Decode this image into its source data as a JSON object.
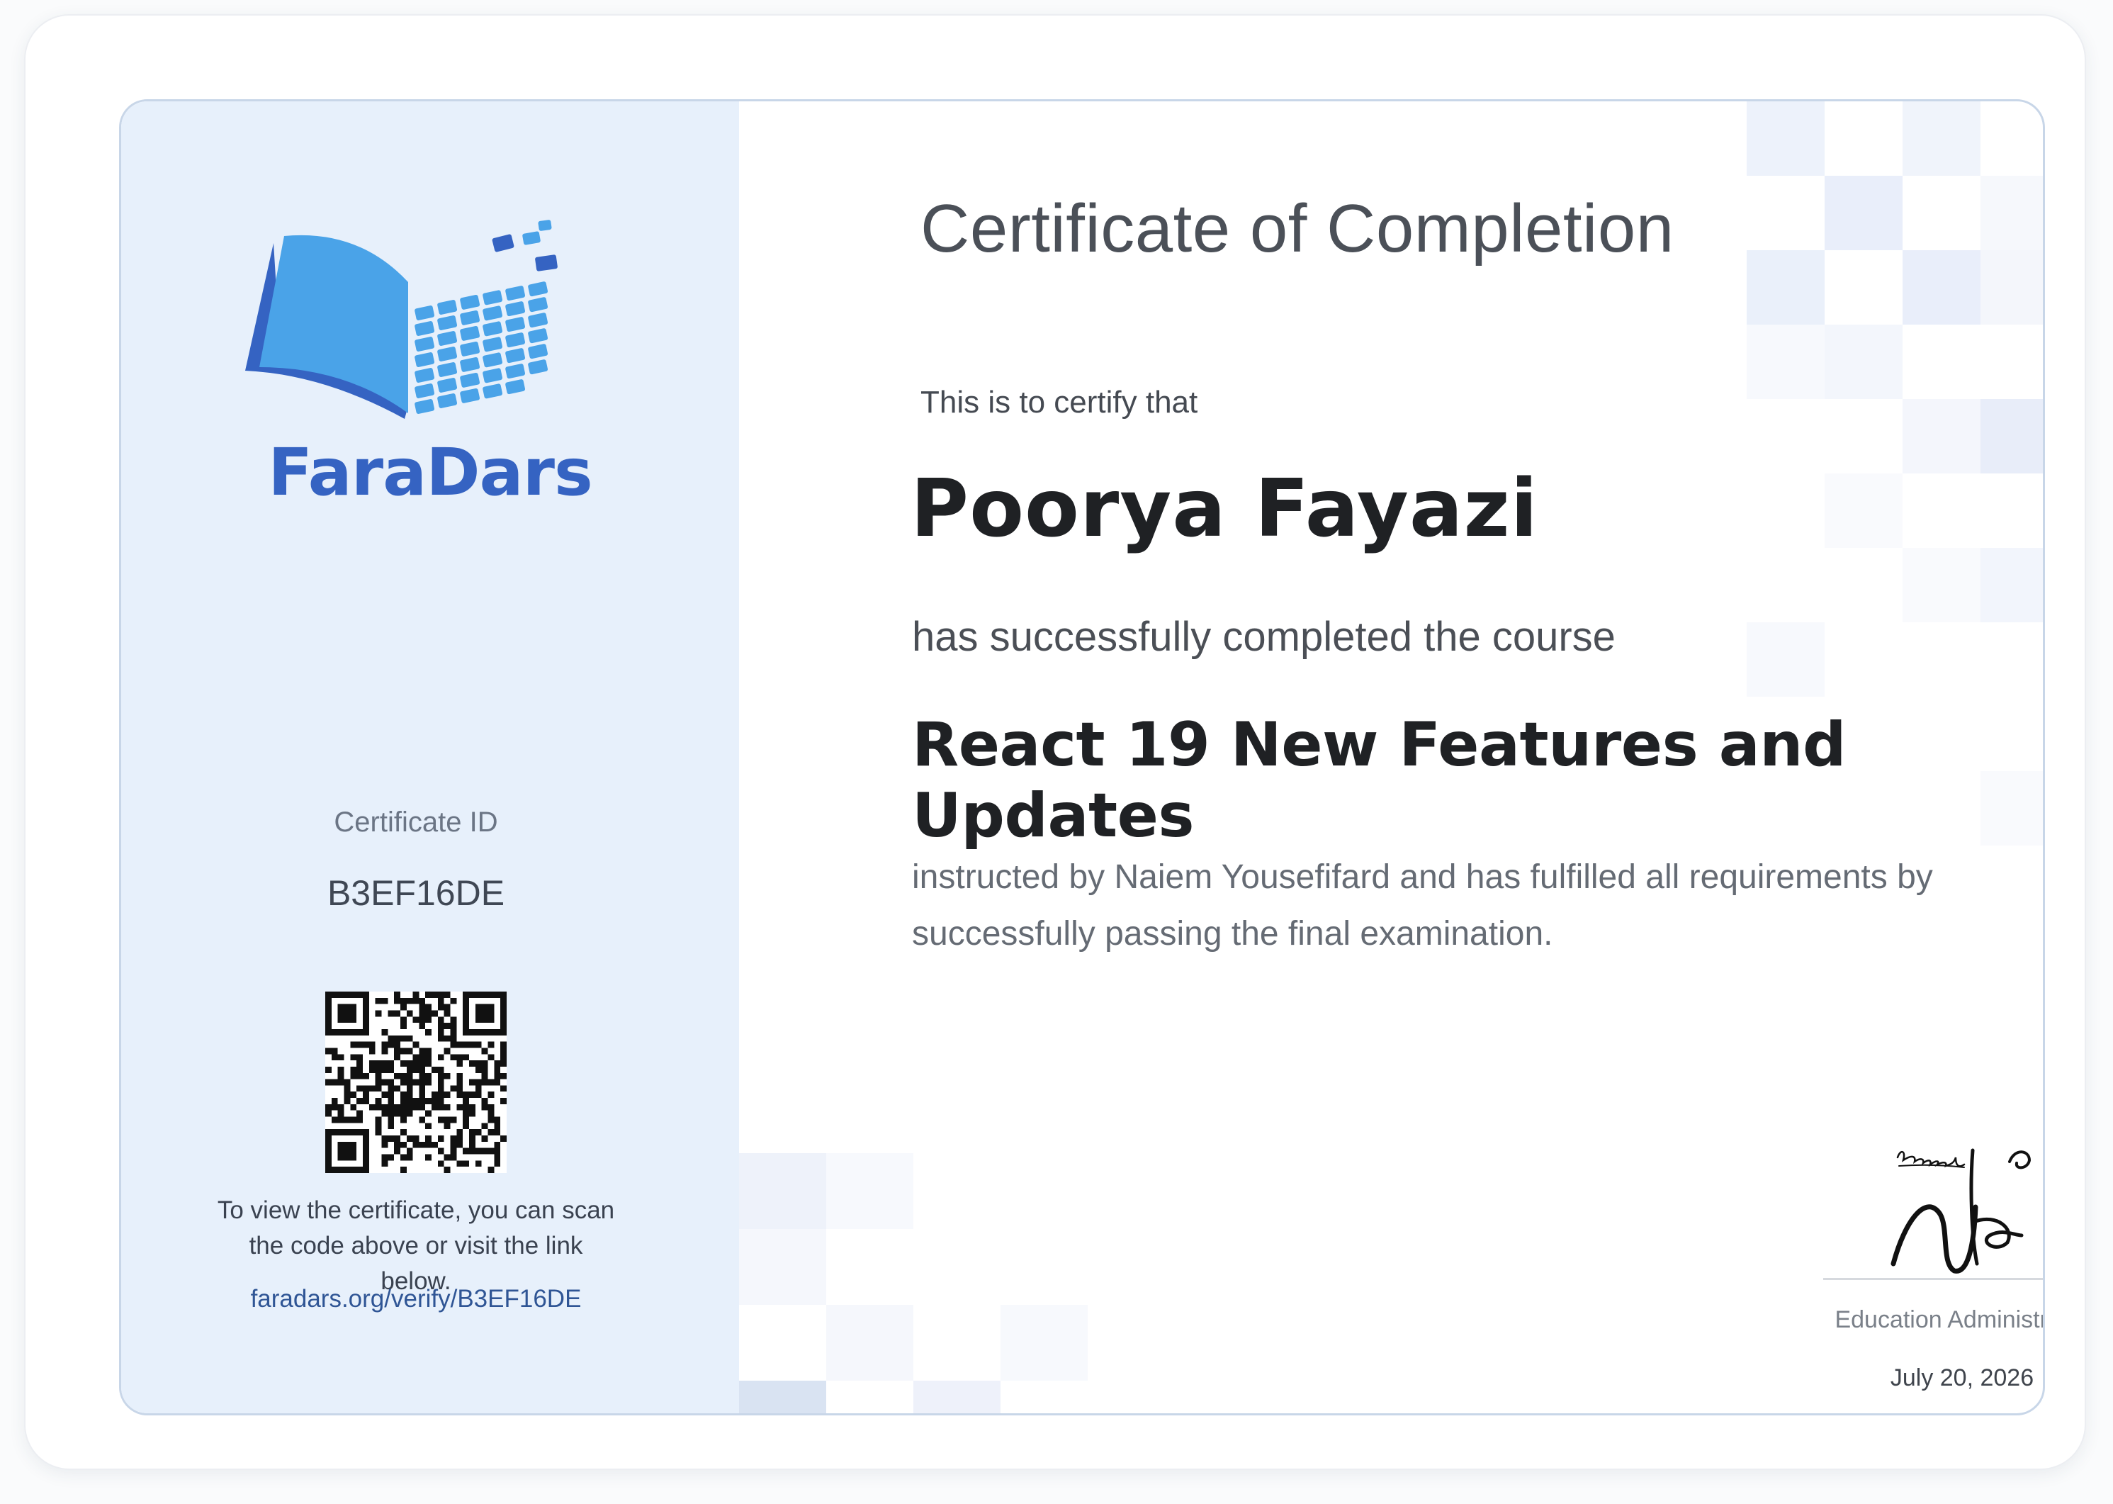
{
  "brand": {
    "name": "FaraDars",
    "logo_icon": "open-book-pixel-logo",
    "colors": {
      "primary": "#3563c2",
      "light": "#4aa3e8",
      "panel": "#e7f0fb"
    }
  },
  "certificate": {
    "title": "Certificate of Completion",
    "certify_intro": "This is to certify that",
    "recipient_name": "Poorya Fayazi",
    "completion_text": "has successfully completed the course",
    "course_title": "React 19 New Features and Updates",
    "instruction_text": "instructed by Naiem Yousefifard and has fulfilled all requirements by successfully passing the final examination."
  },
  "verification": {
    "id_label": "Certificate ID",
    "id_value": "B3EF16DE",
    "qr_icon": "qr-code-icon",
    "help_text": "To view the certificate, you can scan the code above or visit the link below.",
    "link_text": "faradars.org/verify/B3EF16DE"
  },
  "signature": {
    "role": "Education Administrator",
    "date": "July 20, 2026"
  }
}
